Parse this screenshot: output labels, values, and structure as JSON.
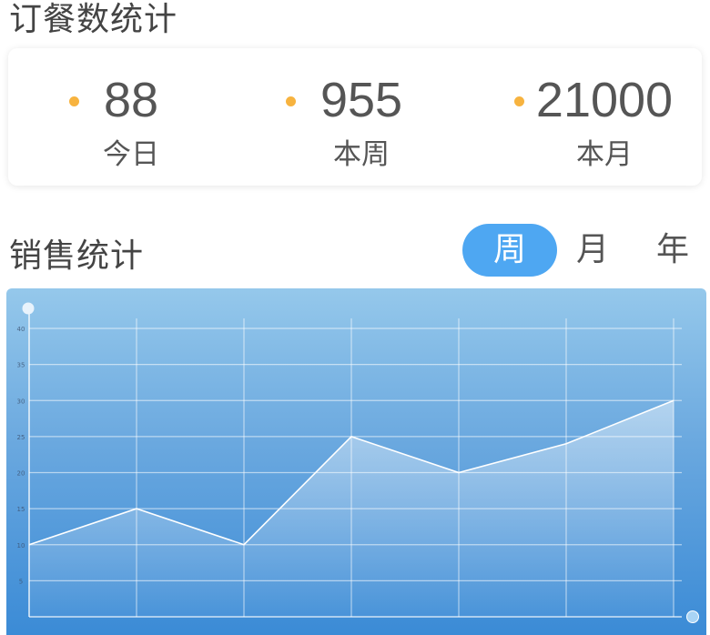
{
  "order_section": {
    "title": "订餐数统计",
    "stats": [
      {
        "value": "88",
        "label": "今日"
      },
      {
        "value": "955",
        "label": "本周"
      },
      {
        "value": "21000",
        "label": "本月"
      }
    ],
    "dot_color": "#f7b33f"
  },
  "sales_section": {
    "title": "销售统计",
    "tabs": [
      {
        "label": "周",
        "selected": true
      },
      {
        "label": "月",
        "selected": false
      },
      {
        "label": "年",
        "selected": false
      }
    ],
    "accent_color": "#4ea7f2"
  },
  "chart_data": {
    "type": "area",
    "y_ticks": [
      "40",
      "35",
      "30",
      "25",
      "20",
      "15",
      "10",
      "5"
    ],
    "ylim": [
      0,
      40
    ],
    "values": [
      10,
      15,
      10,
      25,
      20,
      24,
      30
    ],
    "grid": true
  }
}
